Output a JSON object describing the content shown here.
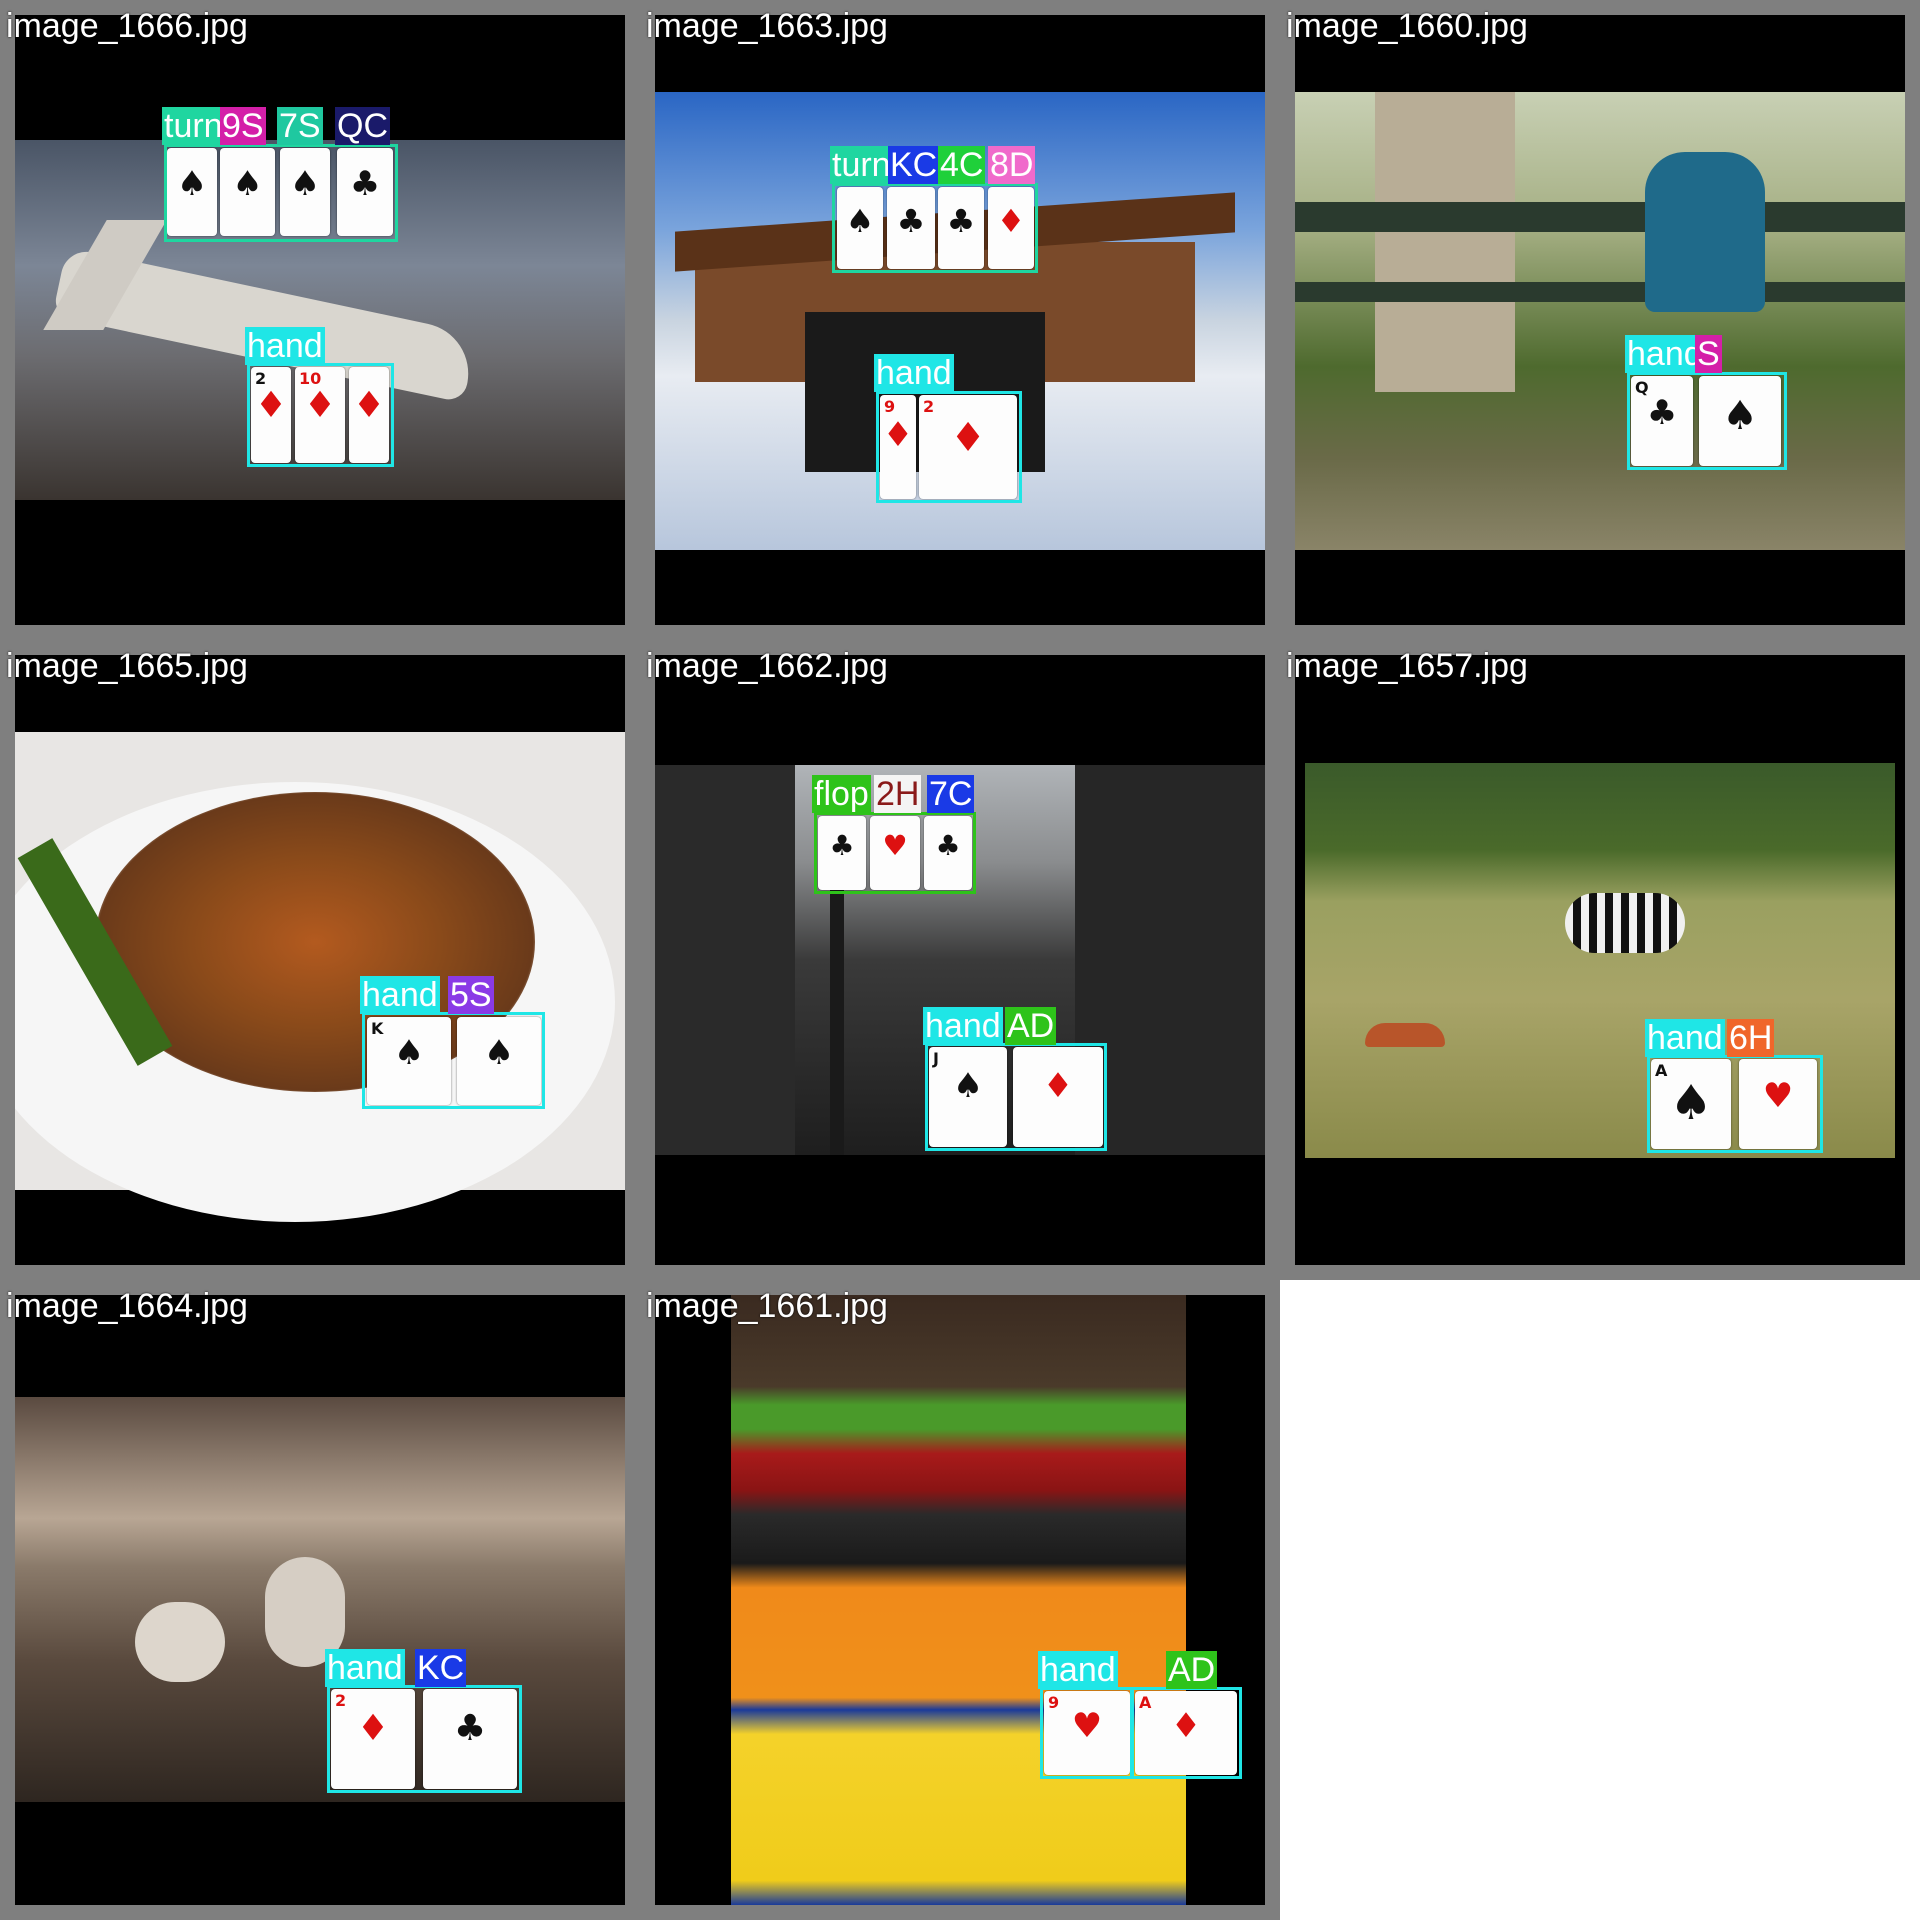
{
  "tiles": [
    {
      "filename": "image_1666.jpg",
      "scene": "hangar",
      "labels": [
        {
          "text": "turn",
          "color": "#1fd6a0"
        },
        {
          "text": "9S",
          "color": "#d41fa8"
        },
        {
          "text": "7S",
          "color": "#1fc8a0"
        },
        {
          "text": "QC",
          "color": "#1a1a6a"
        },
        {
          "text": "hand",
          "color": "#1fe6e6"
        }
      ],
      "cards": [
        {
          "rank": "",
          "suit": "♠",
          "color": "blk"
        },
        {
          "rank": "",
          "suit": "♠",
          "color": "blk"
        },
        {
          "rank": "",
          "suit": "♠",
          "color": "blk"
        },
        {
          "rank": "",
          "suit": "♣",
          "color": "blk"
        },
        {
          "rank": "2",
          "suit": "♦",
          "color": "red"
        },
        {
          "rank": "10",
          "suit": "♦",
          "color": "red"
        },
        {
          "rank": "",
          "suit": "♦",
          "color": "red"
        }
      ]
    },
    {
      "filename": "image_1663.jpg",
      "scene": "ski",
      "labels": [
        {
          "text": "turn",
          "color": "#1fd6a0"
        },
        {
          "text": "KC",
          "color": "#1a3ae6"
        },
        {
          "text": "4C",
          "color": "#1fd03a"
        },
        {
          "text": "8D",
          "color": "#f06acb"
        },
        {
          "text": "hand",
          "color": "#1fe6e6"
        }
      ],
      "cards": [
        {
          "rank": "",
          "suit": "♠",
          "color": "blk"
        },
        {
          "rank": "",
          "suit": "♣",
          "color": "blk"
        },
        {
          "rank": "",
          "suit": "♣",
          "color": "blk"
        },
        {
          "rank": "",
          "suit": "♦",
          "color": "red"
        },
        {
          "rank": "9",
          "suit": "♦",
          "color": "red"
        },
        {
          "rank": "2",
          "suit": "♦",
          "color": "red"
        }
      ]
    },
    {
      "filename": "image_1660.jpg",
      "scene": "park",
      "labels": [
        {
          "text": "hand",
          "color": "#1fe6e6"
        },
        {
          "text": "S",
          "color": "#d41fa8"
        }
      ],
      "cards": [
        {
          "rank": "Q",
          "suit": "♣",
          "color": "blk"
        },
        {
          "rank": "",
          "suit": "♠",
          "color": "blk"
        }
      ]
    },
    {
      "filename": "image_1665.jpg",
      "scene": "food",
      "labels": [
        {
          "text": "hand",
          "color": "#1fe6e6"
        },
        {
          "text": "5S",
          "color": "#8a3ae6"
        }
      ],
      "cards": [
        {
          "rank": "K",
          "suit": "♠",
          "color": "blk"
        },
        {
          "rank": "",
          "suit": "♠",
          "color": "blk"
        }
      ]
    },
    {
      "filename": "image_1662.jpg",
      "scene": "street",
      "labels": [
        {
          "text": "flop",
          "color": "#2ec31a"
        },
        {
          "text": "2H",
          "color": "#f4f4f4"
        },
        {
          "text": "7C",
          "color": "#1a3ae6"
        },
        {
          "text": "hand",
          "color": "#1fe6e6"
        },
        {
          "text": "AD",
          "color": "#2ec31a"
        }
      ],
      "cards": [
        {
          "rank": "",
          "suit": "♣",
          "color": "blk"
        },
        {
          "rank": "",
          "suit": "♥",
          "color": "red"
        },
        {
          "rank": "",
          "suit": "♣",
          "color": "blk"
        },
        {
          "rank": "J",
          "suit": "♠",
          "color": "blk"
        },
        {
          "rank": "",
          "suit": "♦",
          "color": "red"
        }
      ]
    },
    {
      "filename": "image_1657.jpg",
      "scene": "savanna",
      "labels": [
        {
          "text": "hand",
          "color": "#1fe6e6"
        },
        {
          "text": "6H",
          "color": "#f0662a"
        }
      ],
      "cards": [
        {
          "rank": "A",
          "suit": "♠",
          "color": "blk"
        },
        {
          "rank": "",
          "suit": "♥",
          "color": "red"
        }
      ]
    },
    {
      "filename": "image_1664.jpg",
      "scene": "sheep",
      "labels": [
        {
          "text": "hand",
          "color": "#1fe6e6"
        },
        {
          "text": "KC",
          "color": "#1a3ae6"
        }
      ],
      "cards": [
        {
          "rank": "2",
          "suit": "♦",
          "color": "red"
        },
        {
          "rank": "",
          "suit": "♣",
          "color": "blk"
        }
      ]
    },
    {
      "filename": "image_1661.jpg",
      "scene": "fruit",
      "labels": [
        {
          "text": "hand",
          "color": "#1fe6e6"
        },
        {
          "text": "AD",
          "color": "#2ec31a"
        }
      ],
      "cards": [
        {
          "rank": "9",
          "suit": "♥",
          "color": "red"
        },
        {
          "rank": "A",
          "suit": "♦",
          "color": "red"
        }
      ]
    }
  ],
  "colors": {
    "grid_border": "#7f7f7f",
    "letterbox": "#000000",
    "hand_box": "#1fe6e6"
  }
}
